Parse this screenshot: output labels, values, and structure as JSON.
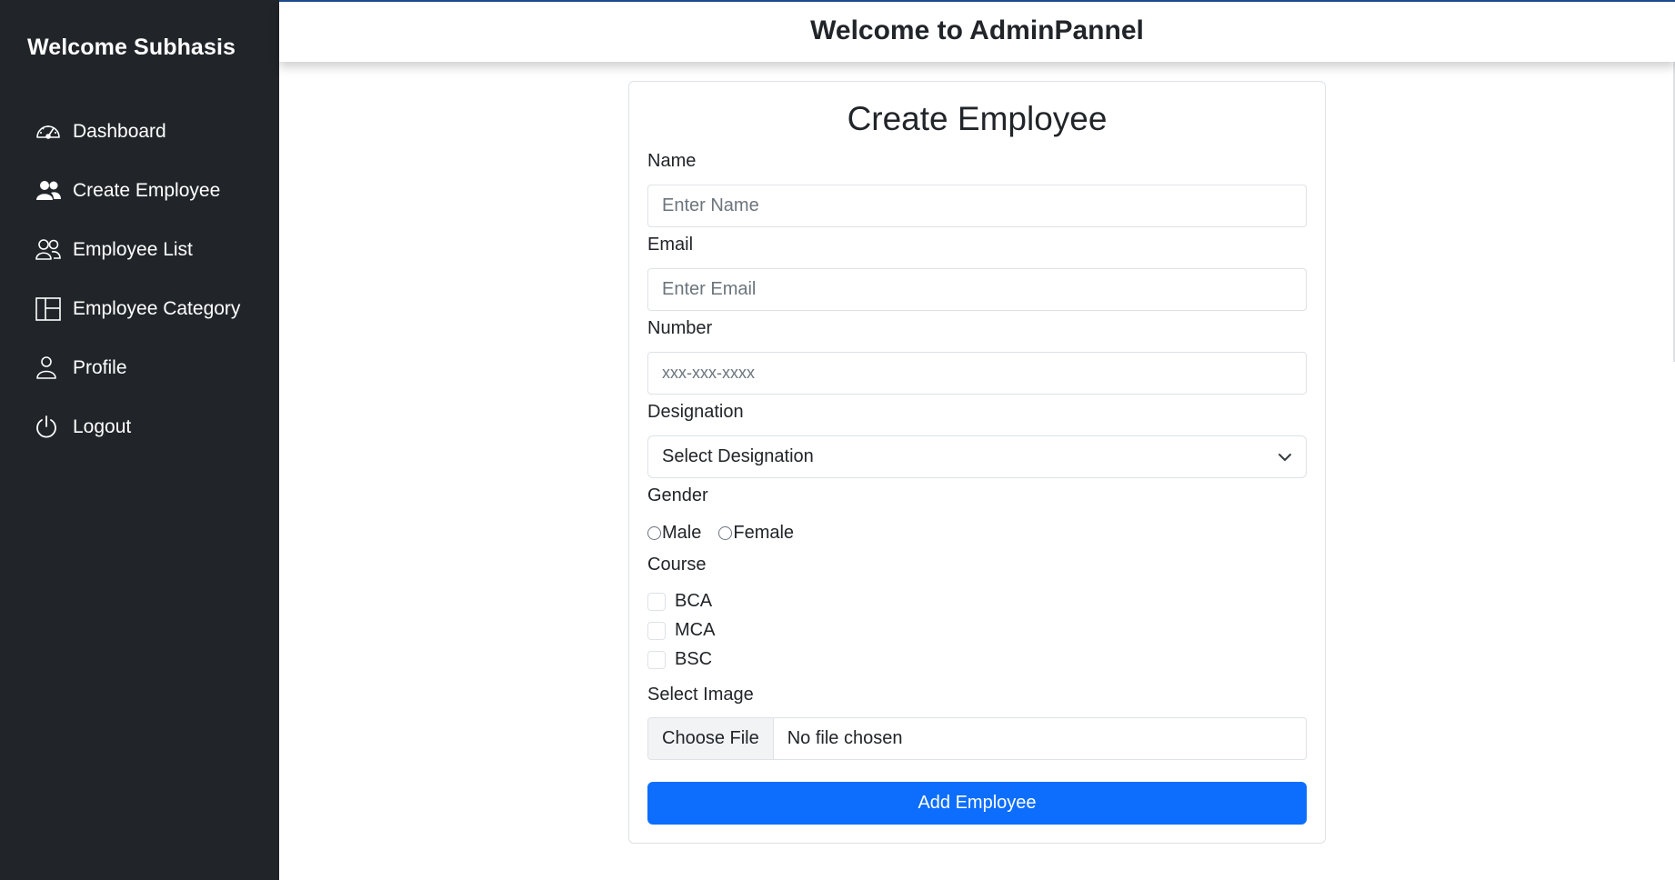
{
  "sidebar": {
    "brand": "Welcome Subhasis",
    "items": [
      {
        "label": "Dashboard",
        "icon": "speedometer-icon"
      },
      {
        "label": "Create Employee",
        "icon": "people-fill-icon"
      },
      {
        "label": "Employee List",
        "icon": "people-icon"
      },
      {
        "label": "Employee Category",
        "icon": "layout-icon"
      },
      {
        "label": "Profile",
        "icon": "person-icon"
      },
      {
        "label": "Logout",
        "icon": "power-icon"
      }
    ]
  },
  "header": {
    "title": "Welcome to AdminPannel"
  },
  "form": {
    "title": "Create Employee",
    "name": {
      "label": "Name",
      "placeholder": "Enter Name",
      "value": ""
    },
    "email": {
      "label": "Email",
      "placeholder": "Enter Email",
      "value": ""
    },
    "number": {
      "label": "Number",
      "placeholder": "xxx-xxx-xxxx",
      "value": ""
    },
    "designation": {
      "label": "Designation",
      "selected": "Select Designation"
    },
    "gender": {
      "label": "Gender",
      "options": [
        "Male",
        "Female"
      ]
    },
    "course": {
      "label": "Course",
      "options": [
        "BCA",
        "MCA",
        "BSC"
      ]
    },
    "image": {
      "label": "Select Image",
      "button": "Choose File",
      "status": "No file chosen"
    },
    "submit_label": "Add Employee"
  },
  "colors": {
    "sidebar_bg": "#212529",
    "primary": "#0d6efd",
    "accent_top": "#1c4c8e"
  }
}
